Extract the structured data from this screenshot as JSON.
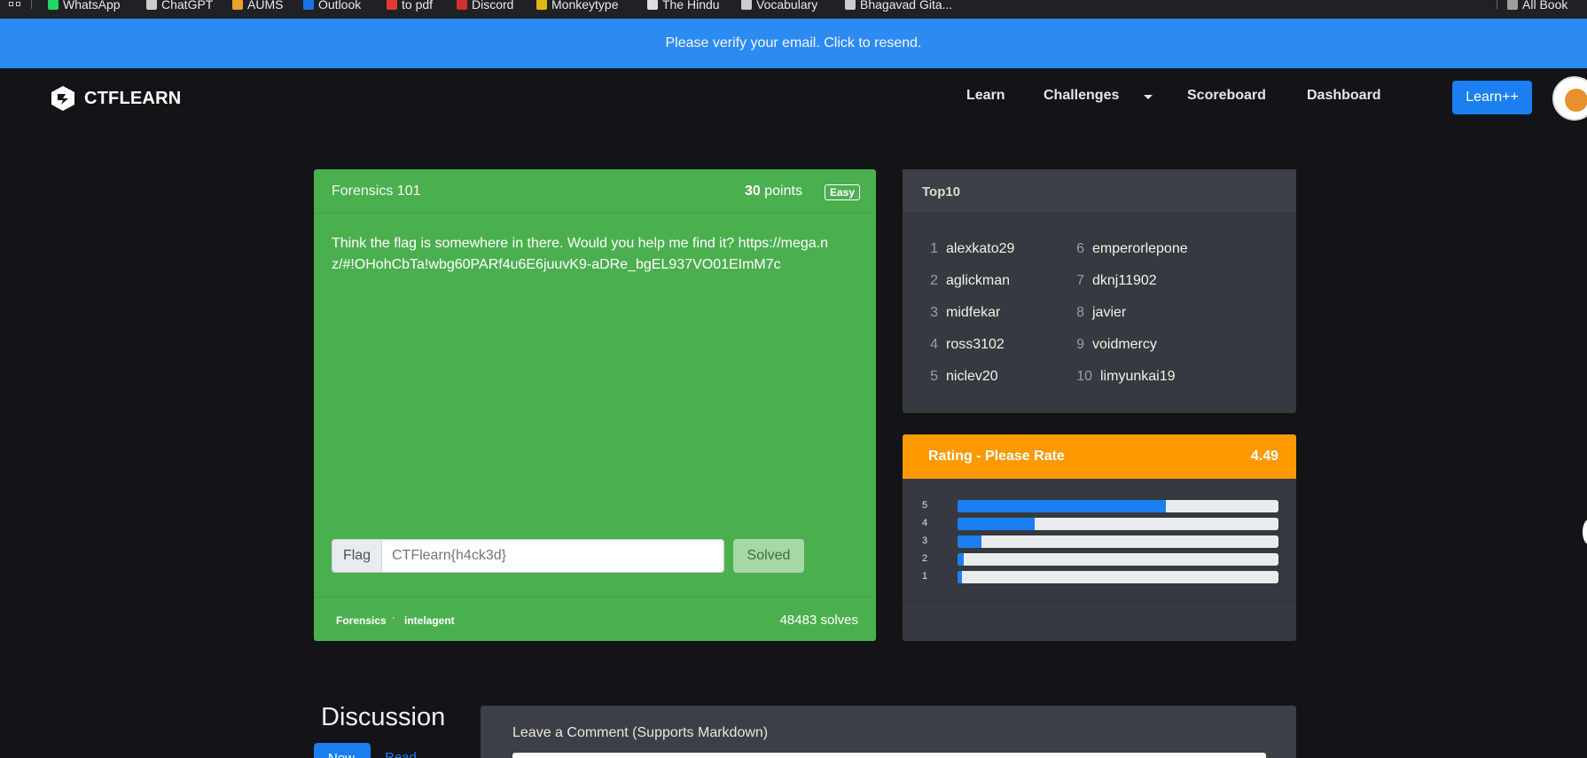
{
  "bookmarks": [
    {
      "label": "WhatsApp",
      "icon": "whatsapp-icon",
      "color": "#25d366"
    },
    {
      "label": "ChatGPT",
      "icon": "chatgpt-icon",
      "color": "#cccccc"
    },
    {
      "label": "AUMS",
      "icon": "aums-icon",
      "color": "#e8a030"
    },
    {
      "label": "Outlook",
      "icon": "outlook-icon",
      "color": "#1a73e8"
    },
    {
      "label": "to pdf",
      "icon": "pdf-icon",
      "color": "#e53935"
    },
    {
      "label": "Discord",
      "icon": "discord-icon",
      "color": "#d32f2f"
    },
    {
      "label": "Monkeytype",
      "icon": "monkeytype-icon",
      "color": "#e2b714"
    },
    {
      "label": "The Hindu",
      "icon": "thehindu-icon",
      "color": "#dddddd"
    },
    {
      "label": "Vocabulary",
      "icon": "vocabulary-icon",
      "color": "#cccccc"
    },
    {
      "label": "Bhagavad Gita...",
      "icon": "gita-icon",
      "color": "#cccccc"
    }
  ],
  "bookmarks_all": "All Book",
  "banner": {
    "text": "Please verify your email. Click to resend.",
    "color": "#2c8af0"
  },
  "nav": {
    "brand": "CTFLEARN",
    "links": [
      "Learn",
      "Challenges",
      "Scoreboard",
      "Dashboard"
    ],
    "cta": "Learn++"
  },
  "challenge": {
    "title": "Forensics 101",
    "points_value": "30",
    "points_label": "points",
    "difficulty": "Easy",
    "description": "Think the flag is somewhere in there. Would you help me find it? https://mega.nz/#!OHohCbTa!wbg60PARf4u6E6juuvK9-aDRe_bgEL937VO01EImM7c",
    "flag_label": "Flag",
    "flag_placeholder": "CTFlearn{h4ck3d}",
    "solved_label": "Solved",
    "category": "Forensics",
    "author": "intelagent",
    "solves": "48483 solves",
    "color": "#4caf4f"
  },
  "top10": {
    "title": "Top10",
    "entries": [
      {
        "rank": "1",
        "name": "alexkato29"
      },
      {
        "rank": "2",
        "name": "aglickman"
      },
      {
        "rank": "3",
        "name": "midfekar"
      },
      {
        "rank": "4",
        "name": "ross3102"
      },
      {
        "rank": "5",
        "name": "niclev20"
      },
      {
        "rank": "6",
        "name": "emperorlepone"
      },
      {
        "rank": "7",
        "name": "dknj11902"
      },
      {
        "rank": "8",
        "name": "javier"
      },
      {
        "rank": "9",
        "name": "voidmercy"
      },
      {
        "rank": "10",
        "name": "limyunkai19"
      }
    ]
  },
  "rating": {
    "title": "Rating - Please Rate",
    "score": "4.49",
    "color": "#ff9900",
    "bars": [
      {
        "label": "5",
        "fraction": 0.65
      },
      {
        "label": "4",
        "fraction": 0.24
      },
      {
        "label": "3",
        "fraction": 0.075
      },
      {
        "label": "2",
        "fraction": 0.02
      },
      {
        "label": "1",
        "fraction": 0.015
      }
    ]
  },
  "discussion": {
    "title": "Discussion",
    "new_label": "New",
    "read_label": "Read",
    "comment_label": "Leave a Comment (Supports Markdown)"
  }
}
